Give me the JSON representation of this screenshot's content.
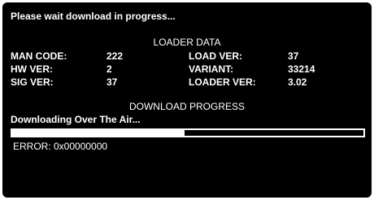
{
  "header": {
    "status_message": "Please wait download in progress..."
  },
  "loader": {
    "section_title": "LOADER DATA",
    "rows": [
      {
        "label_left": "MAN CODE:",
        "value_left": "222",
        "label_right": "LOAD VER:",
        "value_right": "37"
      },
      {
        "label_left": "HW VER:",
        "value_left": "2",
        "label_right": "VARIANT:",
        "value_right": "33214"
      },
      {
        "label_left": "SIG VER:",
        "value_left": "37",
        "label_right": "LOADER VER:",
        "value_right": "3.02"
      }
    ]
  },
  "download": {
    "section_title": "DOWNLOAD PROGRESS",
    "status": "Downloading Over The Air...",
    "progress": 0.49
  },
  "error": {
    "text": "ERROR: 0x00000000"
  },
  "colors": {
    "background": "#000000",
    "foreground": "#ffffff"
  }
}
